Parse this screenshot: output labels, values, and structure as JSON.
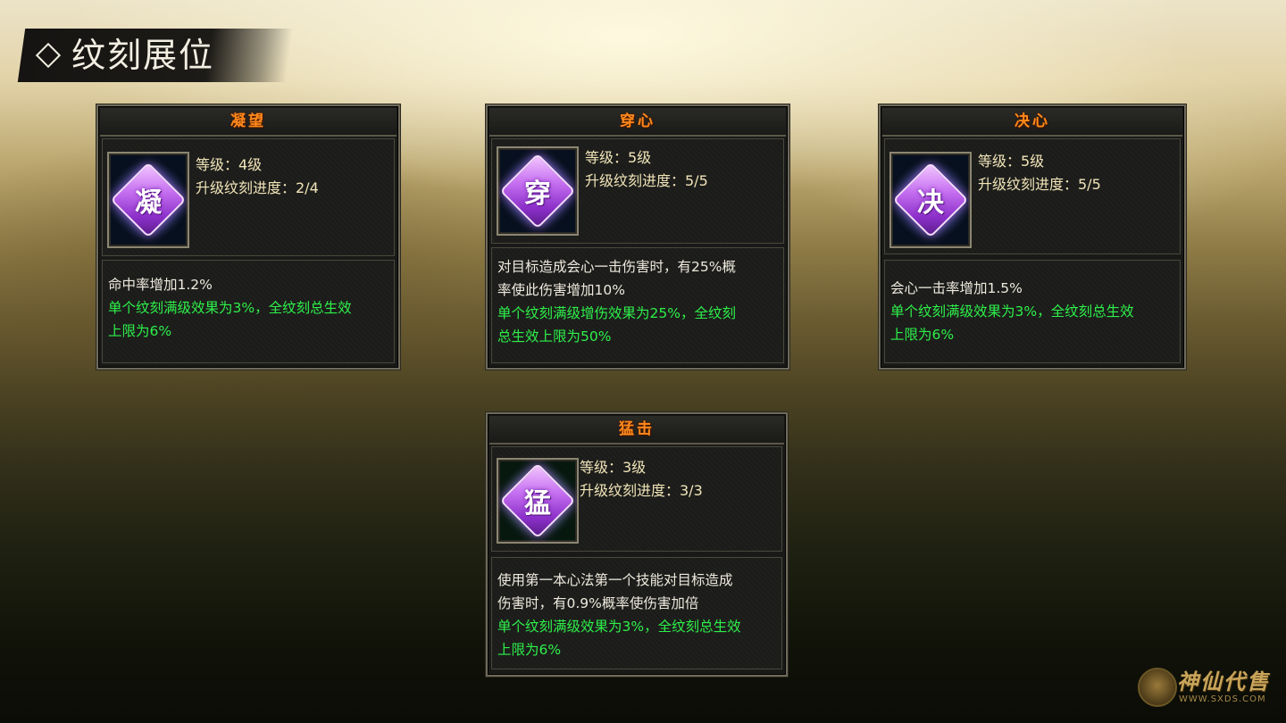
{
  "header": {
    "title": "纹刻展位"
  },
  "panels": [
    {
      "title": "凝望",
      "glyph": "凝",
      "level": "等级：4级",
      "progress": "升级纹刻进度：2/4",
      "desc": [
        "命中率增加1.2%"
      ],
      "bonus": [
        "单个纹刻满级效果为3%，全纹刻总生效",
        "上限为6%"
      ]
    },
    {
      "title": "穿心",
      "glyph": "穿",
      "level": "等级：5级",
      "progress": "升级纹刻进度：5/5",
      "desc": [
        "对目标造成会心一击伤害时，有25%概",
        "率使此伤害增加10%"
      ],
      "bonus": [
        "单个纹刻满级增伤效果为25%，全纹刻",
        "总生效上限为50%"
      ]
    },
    {
      "title": "决心",
      "glyph": "决",
      "level": "等级：5级",
      "progress": "升级纹刻进度：5/5",
      "desc": [
        "会心一击率增加1.5%"
      ],
      "bonus": [
        "单个纹刻满级效果为3%，全纹刻总生效",
        "上限为6%"
      ]
    },
    {
      "title": "猛击",
      "glyph": "猛",
      "level": "等级：3级",
      "progress": "升级纹刻进度：3/3",
      "desc": [
        "使用第一本心法第一个技能对目标造成",
        "伤害时，有0.9%概率使伤害加倍"
      ],
      "bonus": [
        "单个纹刻满级效果为3%，全纹刻总生效",
        "上限为6%"
      ]
    }
  ],
  "watermark": {
    "name": "神仙代售",
    "url": "WWW.SXDS.COM"
  },
  "colors": {
    "title": "#ff8a1c",
    "bonus": "#2ef04a",
    "info": "#f1e4b8"
  },
  "icons": [
    "diamond-icon",
    "rune-gem-icon",
    "emblem-icon"
  ]
}
